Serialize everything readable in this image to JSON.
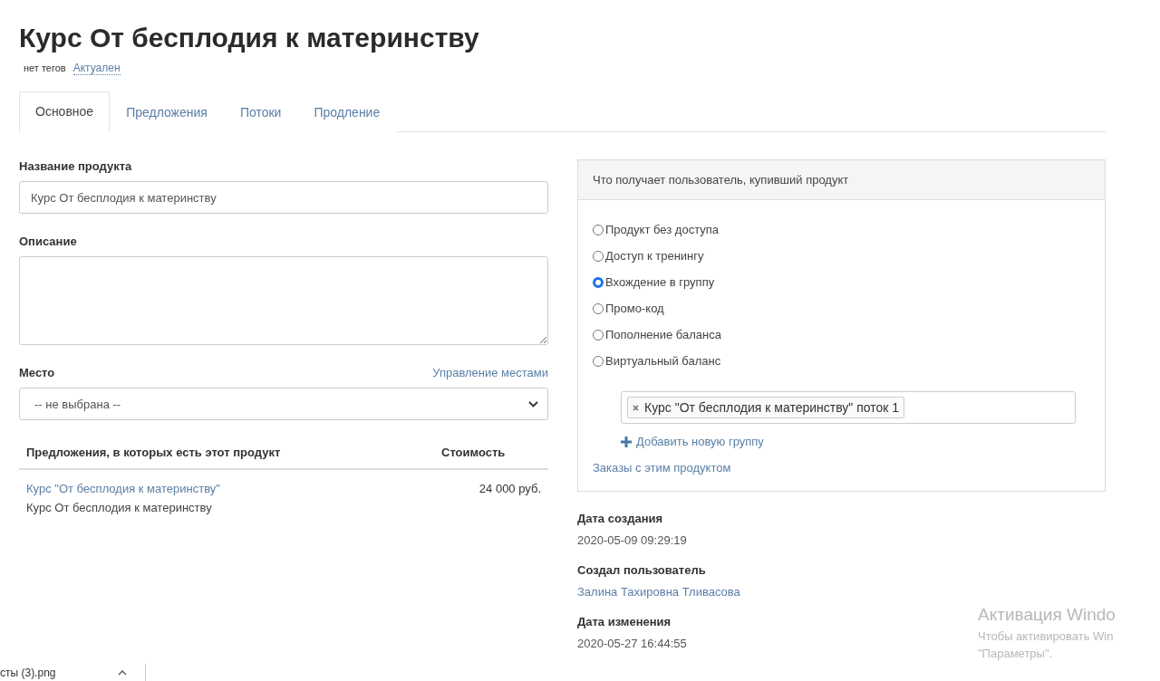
{
  "page": {
    "title": "Курс От бесплодия к материнству",
    "tags_label": "нет тегов",
    "status_link": "Актуален"
  },
  "tabs": [
    {
      "label": "Основное",
      "selected": true
    },
    {
      "label": "Предложения",
      "selected": false
    },
    {
      "label": "Потоки",
      "selected": false
    },
    {
      "label": "Продление",
      "selected": false
    }
  ],
  "form": {
    "name_label": "Название продукта",
    "name_value": "Курс От бесплодия к материнству",
    "description_label": "Описание",
    "place_label": "Место",
    "place_link": "Управление местами",
    "place_value": "-- не выбрана --"
  },
  "offers": {
    "columns": [
      "Предложения, в которых есть этот продукт",
      "Стоимость"
    ],
    "rows": [
      {
        "link": "Курс \"От бесплодия к материнству\"",
        "subtitle": "Курс От бесплодия к материнству",
        "price": "24 000 руб."
      }
    ]
  },
  "access": {
    "title": "Что получает пользователь, купивший продукт",
    "options": [
      {
        "label": "Продукт без доступа",
        "selected": false
      },
      {
        "label": "Доступ к тренингу",
        "selected": false
      },
      {
        "label": "Вхождение в группу",
        "selected": true
      },
      {
        "label": "Промо-код",
        "selected": false
      },
      {
        "label": "Пополнение баланса",
        "selected": false
      },
      {
        "label": "Виртуальный баланс",
        "selected": false
      }
    ],
    "groups": [
      {
        "label": "Курс \"От бесплодия к материнству\" поток 1"
      }
    ],
    "add_group": "Добавить новую группу",
    "orders_link": "Заказы с этим продуктом"
  },
  "meta": [
    {
      "label": "Дата создания",
      "value": "2020-05-09 09:29:19",
      "kind": "text"
    },
    {
      "label": "Создал пользователь",
      "value": "Залина Тахировна Тливасова",
      "kind": "link"
    },
    {
      "label": "Дата изменения",
      "value": "2020-05-27 16:44:55",
      "kind": "text"
    }
  ],
  "activation": {
    "title": "Активация Windo",
    "line_1": "Чтобы активировать Win",
    "line_2": "\"Параметры\"."
  },
  "download_bar": {
    "file": "сты (3).png"
  }
}
